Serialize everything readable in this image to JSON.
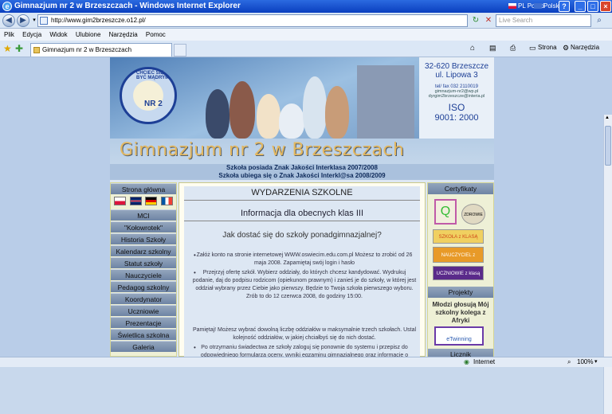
{
  "window": {
    "title": "Gimnazjum nr 2 w Brzeszczach - Windows Internet Explorer",
    "lang_label": "PL Polski",
    "kbd_label": "Polski"
  },
  "address": {
    "url": "http://www.gim2brzeszcze.o12.pl/",
    "search_placeholder": "Live Search"
  },
  "menu": [
    "Plik",
    "Edycja",
    "Widok",
    "Ulubione",
    "Narzędzia",
    "Pomoc"
  ],
  "tab": {
    "label": "Gimnazjum nr 2 w Brzeszczach"
  },
  "toolbar": {
    "page_label": "Strona",
    "tools_label": "Narzędzia"
  },
  "banner": {
    "school_name": "Gimnazjum nr 2 w Brzeszczach",
    "logo_motto": "CHCIEĆ SIĘ BYĆ MĄDRYM",
    "logo_nr": "NR 2",
    "address_line1": "32-620 Brzeszcze",
    "address_line2": "ul. Lipowa 3",
    "tel": "tel/ fax 032 2110019",
    "email1": "gimnazjum-nr2@wp.pl",
    "email2": "dyrgim2brzeszcze@interia.pl",
    "iso1": "ISO",
    "iso2": "9001: 2000",
    "quality1": "Szkoła posiada Znak Jakości Interklasa 2007/2008",
    "quality2": "Szkoła ubiega się o Znak Jakości Interkl@sa 2008/2009"
  },
  "left_nav": {
    "top": "Strona główna",
    "items": [
      "MCI",
      "\"Kołowrotek\"",
      "Historia Szkoły",
      "Kalendarz szkolny",
      "Statut szkoły",
      "Nauczyciele",
      "Pedagog szkolny",
      "Koordynator",
      "Uczniowie",
      "Prezentacje",
      "Świetlica szkolna",
      "Galeria"
    ]
  },
  "flags": [
    {
      "name": "pl",
      "colors": [
        "#ffffff",
        "#dc143c"
      ]
    },
    {
      "name": "uk",
      "colors": [
        "#012169",
        "#c8102e"
      ]
    },
    {
      "name": "de",
      "colors": [
        "#000000",
        "#dd0000",
        "#ffce00"
      ]
    },
    {
      "name": "fr",
      "colors": [
        "#0055a4",
        "#ffffff",
        "#ef4135"
      ]
    }
  ],
  "main": {
    "section_title": "WYDARZENIA SZKOLNE",
    "article_title": "Informacja dla obecnych klas III",
    "question": "Jak dostać się do szkoły ponadgimnazjalnej?",
    "p1": "Załóż konto na stronie internetowej WWW.oswiecim.edu.com.pl Możesz to zrobić od 26 maja 2008. Zapamiętaj swój login i hasło",
    "p2": "Przejrzyj ofertę szkół. Wybierz oddziały, do których chcesz kandydować. Wydrukuj podanie, daj do podpisu rodzicom (opiekunom prawnym) i zanieś je do szkoły, w której jest oddział wybrany przez Ciebie jako pierwszy. Będzie to Twoja szkoła pierwszego wyboru. Zrób to do 12 czerwca 2008, do godziny 15:00.",
    "p3": "Pamiętaj! Możesz wybrać dowolną liczbę oddziałów w maksymalnie trzech szkołach. Ustal kolejność oddziałów, w jakiej chciałbyś się do nich dostać.",
    "p4": "Po otrzymaniu świadectwa ze szkoły zaloguj się ponownie do systemu i przepisz do odpowiedniego formularza oceny, wyniki egzaminu gimnazjalnego oraz informacje o innych osiągnięciach. Zanieś kopie"
  },
  "right_nav": {
    "certs": "Certyfikaty",
    "badge1": "Q",
    "badge2": "ZDROWIE",
    "badge3": "SZKOŁA z KLASĄ",
    "badge4": "NAUCZYCIEL z KLASĄ",
    "badge5": "UCZNIOWIE z klasą",
    "projects": "Projekty",
    "project_text": "Młodzi głosują Mój szkolny kolega z Afryki",
    "etwinning": "eTwinning",
    "counter": "Licznik"
  },
  "status": {
    "zone": "Internet",
    "zoom": "100%"
  }
}
